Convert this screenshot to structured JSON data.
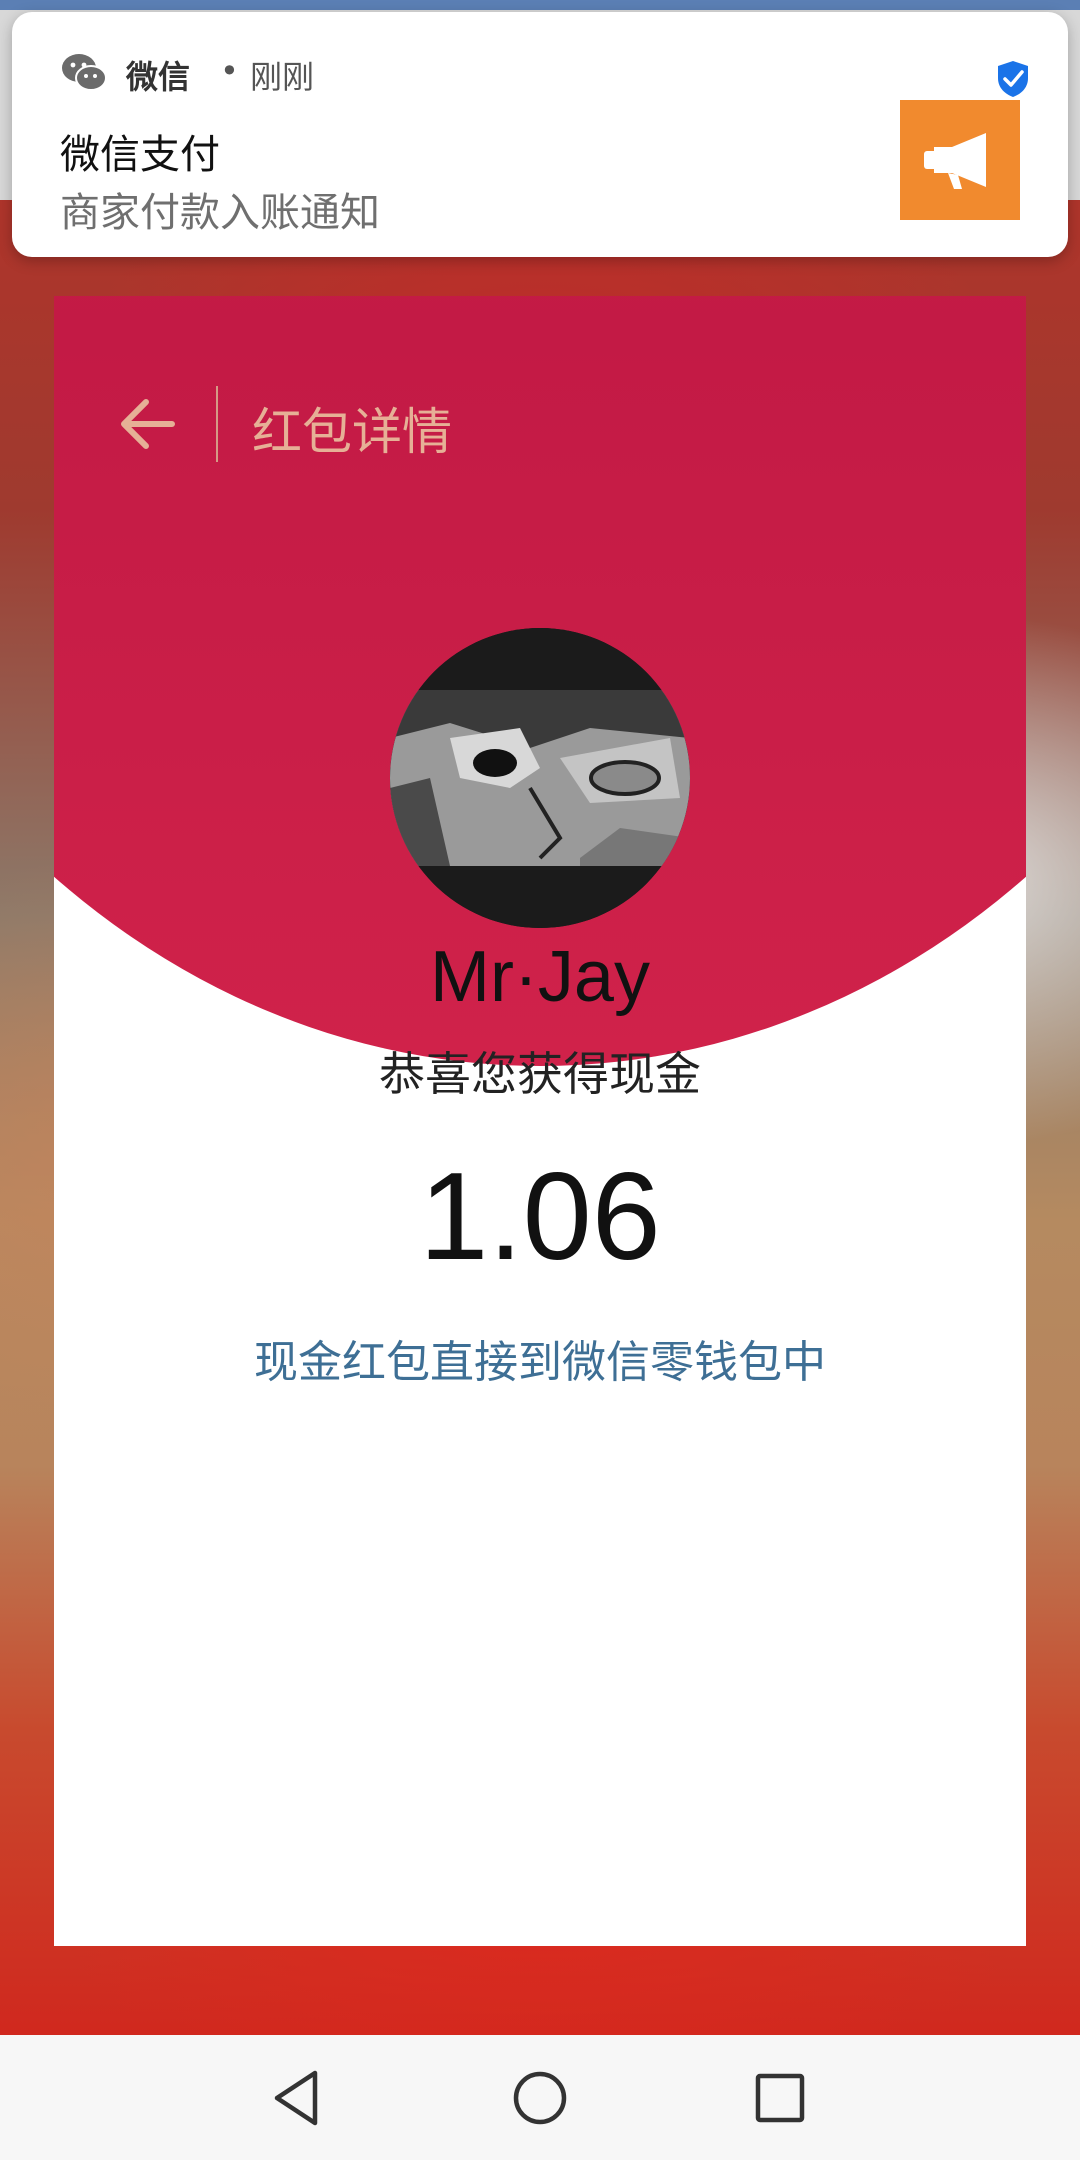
{
  "notification": {
    "app_name": "微信",
    "separator": "•",
    "time": "刚刚",
    "title": "微信支付",
    "body": "商家付款入账通知"
  },
  "red_packet": {
    "header_title": "红包详情",
    "sender_name": "Mr·Jay",
    "message": "恭喜您获得现金",
    "amount": "1.06",
    "note": "现金红包直接到微信零钱包中"
  },
  "icons": {
    "wechat": "wechat-icon",
    "verified": "shield-check-icon",
    "thumb": "megaphone-icon",
    "back": "back-arrow-icon",
    "nav_back": "triangle-back-icon",
    "nav_home": "circle-home-icon",
    "nav_recents": "square-recents-icon"
  },
  "colors": {
    "packet_red": "#c31a45",
    "header_gold": "#e6b096",
    "note_blue": "#3e6f95",
    "thumb_orange": "#f18a2e",
    "verified_blue": "#1a73e8"
  }
}
